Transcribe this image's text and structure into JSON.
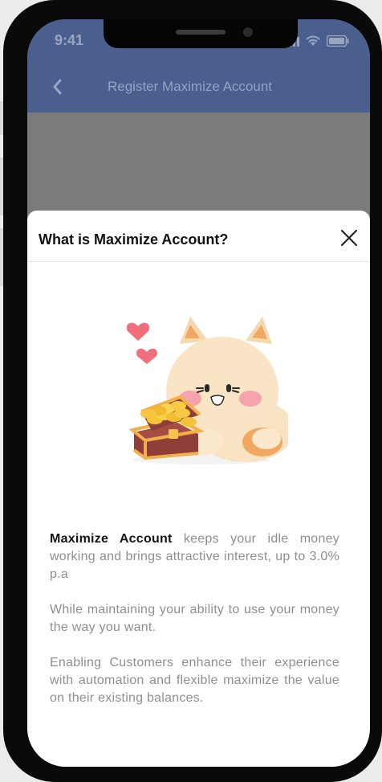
{
  "status_bar": {
    "time": "9:41"
  },
  "nav_bar": {
    "title": "Register Maximize Account"
  },
  "modal": {
    "title": "What is Maximize Account?",
    "paragraph_1": {
      "highlight": "Maximize Account",
      "rest": " keeps your idle money working and brings attractive interest, up to 3.0% p.a"
    },
    "paragraph_2": "While maintaining your ability to use your money the way you want.",
    "paragraph_3": "Enabling Customers enhance their experience with automation and flexible maximize the value on their existing balances."
  },
  "icons": {
    "back": "chevron-left-icon",
    "close": "close-icon"
  },
  "colors": {
    "header": "#4a5f8d",
    "overlay": "#7b7b7b",
    "sheet": "#ffffff",
    "text_highlight": "#141414",
    "text_body": "#8f8f8f"
  }
}
